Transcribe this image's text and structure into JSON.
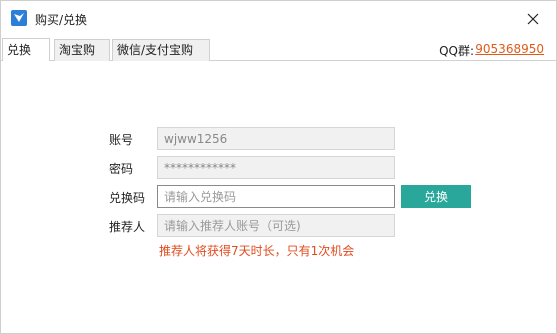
{
  "window": {
    "title": "购买/兑换",
    "icon": "app-logo-icon",
    "close_icon": "close-icon"
  },
  "tabs": [
    {
      "label": "兑换",
      "active": true
    },
    {
      "label": "淘宝购买",
      "active": false
    },
    {
      "label": "微信/支付宝购买",
      "active": false
    }
  ],
  "qq": {
    "label": "QQ群:",
    "number": "905368950"
  },
  "form": {
    "account": {
      "label": "账号",
      "value": "wjww1256"
    },
    "password": {
      "label": "密码",
      "value": "************"
    },
    "code": {
      "label": "兑换码",
      "placeholder": "请输入兑换码",
      "value": ""
    },
    "referrer": {
      "label": "推荐人",
      "placeholder": "请输入推荐人账号（可选)",
      "value": ""
    },
    "redeem_button": "兑换",
    "hint": "推荐人将获得7天时长，只有1次机会"
  },
  "colors": {
    "accent": "#2aa79b",
    "link": "#e05a1a",
    "hint": "#e14b1e"
  }
}
